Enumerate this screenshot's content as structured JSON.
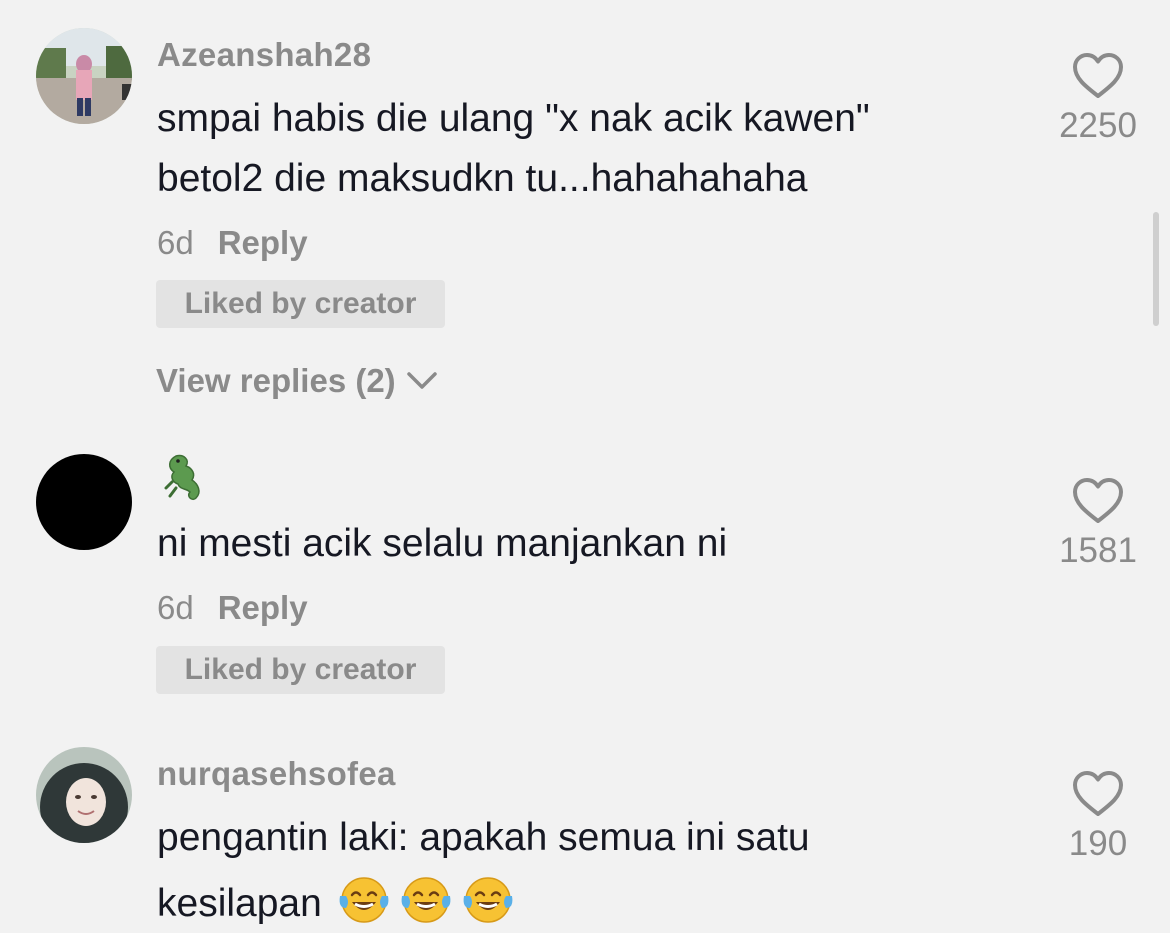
{
  "comments": [
    {
      "username": "Azeanshah28",
      "text_lines": [
        "smpai habis die ulang \"x nak acik kawen\"",
        "betol2 die maksudkn tu...hahahahaha"
      ],
      "age": "6d",
      "reply_label": "Reply",
      "liked_by_creator": "Liked by creator",
      "view_replies": "View replies (2)",
      "like_count": "2250"
    },
    {
      "username_icon": "crocodile-emoji",
      "text_lines": [
        "ni mesti acik selalu manjankan ni"
      ],
      "age": "6d",
      "reply_label": "Reply",
      "liked_by_creator": "Liked by creator",
      "like_count": "1581"
    },
    {
      "username": "nurqasehsofea",
      "text_lines": [
        "pengantin laki: apakah semua ini satu",
        "kesilapan"
      ],
      "trailing_emojis": [
        "face-with-tears-of-joy-emoji",
        "face-with-tears-of-joy-emoji",
        "face-with-tears-of-joy-emoji"
      ],
      "like_count": "190"
    }
  ],
  "icons": {
    "like": "heart-outline-icon",
    "expand": "chevron-down-icon"
  },
  "colors": {
    "background": "#f2f2f2",
    "text": "#161823",
    "muted": "#8a8a8a",
    "pill": "#e3e3e3"
  }
}
